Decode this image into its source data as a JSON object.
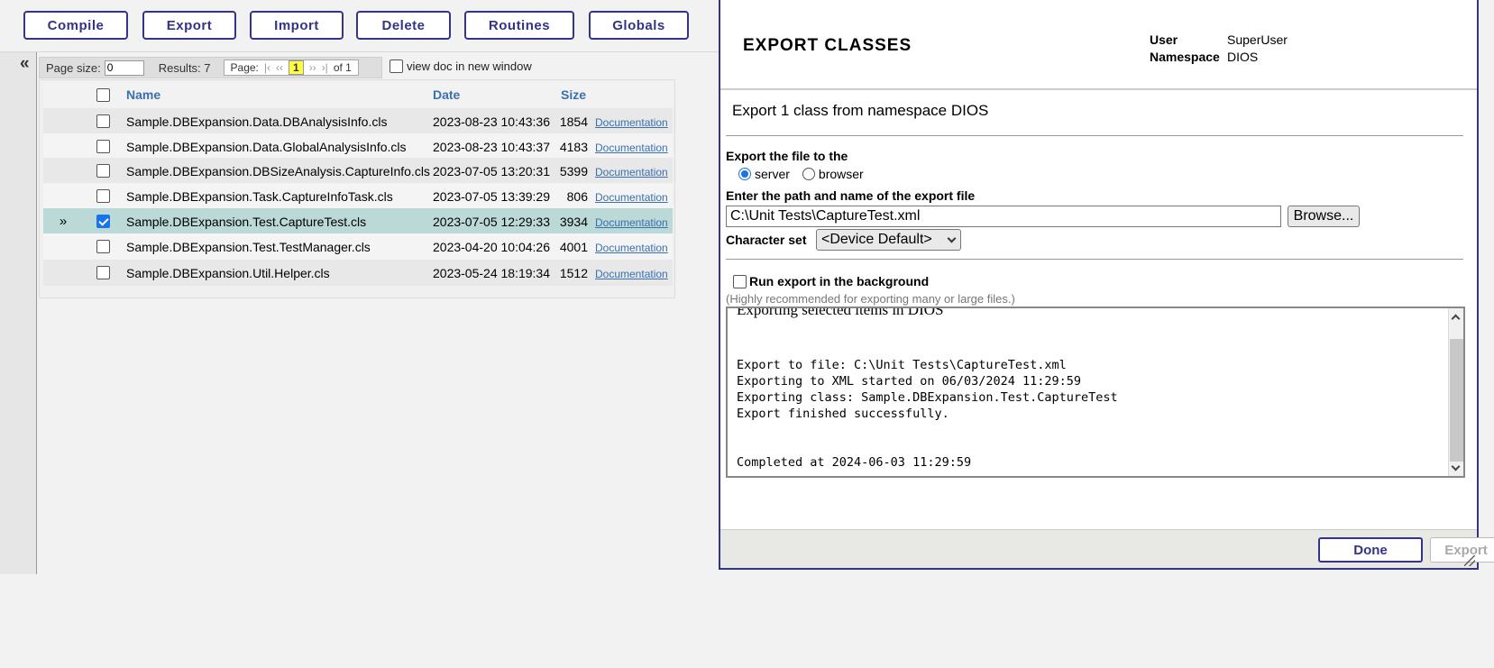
{
  "toolbar": {
    "buttons": [
      "Compile",
      "Export",
      "Import",
      "Delete",
      "Routines",
      "Globals"
    ]
  },
  "collapse_glyph": "«",
  "results_bar": {
    "page_size_label": "Page size:",
    "page_size_value": "0",
    "results_label": "Results: 7",
    "page_label": "Page:",
    "first": "|‹",
    "prev": "‹‹",
    "current_page": "1",
    "next": "››",
    "last": "›|",
    "of_label": "of 1",
    "view_doc_label": "view doc in new window"
  },
  "table": {
    "headers": {
      "name": "Name",
      "date": "Date",
      "size": "Size"
    },
    "rows": [
      {
        "name": "Sample.DBExpansion.Data.DBAnalysisInfo.cls",
        "date": "2023-08-23 10:43:36",
        "size": "1854",
        "doc": "Documentation",
        "selected": false
      },
      {
        "name": "Sample.DBExpansion.Data.GlobalAnalysisInfo.cls",
        "date": "2023-08-23 10:43:37",
        "size": "4183",
        "doc": "Documentation",
        "selected": false
      },
      {
        "name": "Sample.DBExpansion.DBSizeAnalysis.CaptureInfo.cls",
        "date": "2023-07-05 13:20:31",
        "size": "5399",
        "doc": "Documentation",
        "selected": false
      },
      {
        "name": "Sample.DBExpansion.Task.CaptureInfoTask.cls",
        "date": "2023-07-05 13:39:29",
        "size": "806",
        "doc": "Documentation",
        "selected": false
      },
      {
        "name": "Sample.DBExpansion.Test.CaptureTest.cls",
        "date": "2023-07-05 12:29:33",
        "size": "3934",
        "doc": "Documentation",
        "selected": true
      },
      {
        "name": "Sample.DBExpansion.Test.TestManager.cls",
        "date": "2023-04-20 10:04:26",
        "size": "4001",
        "doc": "Documentation",
        "selected": false
      },
      {
        "name": "Sample.DBExpansion.Util.Helper.cls",
        "date": "2023-05-24 18:19:34",
        "size": "1512",
        "doc": "Documentation",
        "selected": false
      }
    ],
    "selected_marker": "»"
  },
  "dialog": {
    "title": "EXPORT CLASSES",
    "user_label": "User",
    "user_value": "SuperUser",
    "namespace_label": "Namespace",
    "namespace_value": "DIOS",
    "subtitle": "Export 1 class from namespace DIOS",
    "export_to_label": "Export the file to the",
    "radio_server": "server",
    "radio_browser": "browser",
    "path_label": "Enter the path and name of the export file",
    "path_value": "C:\\Unit Tests\\CaptureTest.xml",
    "browse_label": "Browse...",
    "charset_label": "Character set",
    "charset_value": "<Device Default>",
    "background_label": "Run export in the background",
    "hint": "(Highly recommended for exporting many or large files.)",
    "log_partial_top": "Exporting selected items in DIOS",
    "log_lines": [
      "",
      "",
      "Export to file: C:\\Unit Tests\\CaptureTest.xml",
      "Exporting to XML started on 06/03/2024 11:29:59",
      "Exporting class: Sample.DBExpansion.Test.CaptureTest",
      "Export finished successfully.",
      "",
      "",
      "Completed at 2024-06-03 11:29:59"
    ],
    "done_label": "Done",
    "export_label": "Export"
  }
}
